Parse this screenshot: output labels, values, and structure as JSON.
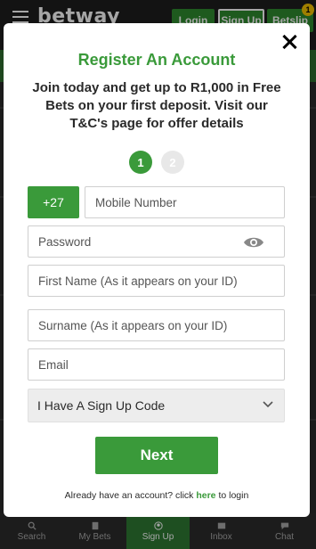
{
  "header": {
    "brand": "betway",
    "login_label": "Login",
    "signup_label": "Sign Up",
    "betslip_label": "Betslip",
    "betslip_count": "1"
  },
  "bottom_nav": {
    "items": [
      {
        "label": "Search",
        "icon": "search-icon"
      },
      {
        "label": "My Bets",
        "icon": "bets-icon"
      },
      {
        "label": "Sign Up",
        "icon": "user-icon"
      },
      {
        "label": "Inbox",
        "icon": "mail-icon"
      },
      {
        "label": "Chat",
        "icon": "chat-icon"
      }
    ],
    "active": "Sign Up"
  },
  "modal": {
    "title": "Register An Account",
    "subtitle": "Join today and get up to R1,000 in Free Bets on your first deposit. Visit our T&C's page for offer details",
    "steps": [
      "1",
      "2"
    ],
    "country_code": "+27",
    "mobile_placeholder": "Mobile Number",
    "password_placeholder": "Password",
    "first_name_placeholder": "First Name (As it appears on your ID)",
    "surname_placeholder": "Surname (As it appears on your ID)",
    "email_placeholder": "Email",
    "signup_code_option": "I Have A Sign Up Code",
    "next_label": "Next",
    "login_prompt": "Already have an account? click",
    "login_link": "here",
    "login_suffix": "to login"
  },
  "colors": {
    "accent": "#3a9a3a",
    "dark_bg": "#1e1e1e"
  }
}
